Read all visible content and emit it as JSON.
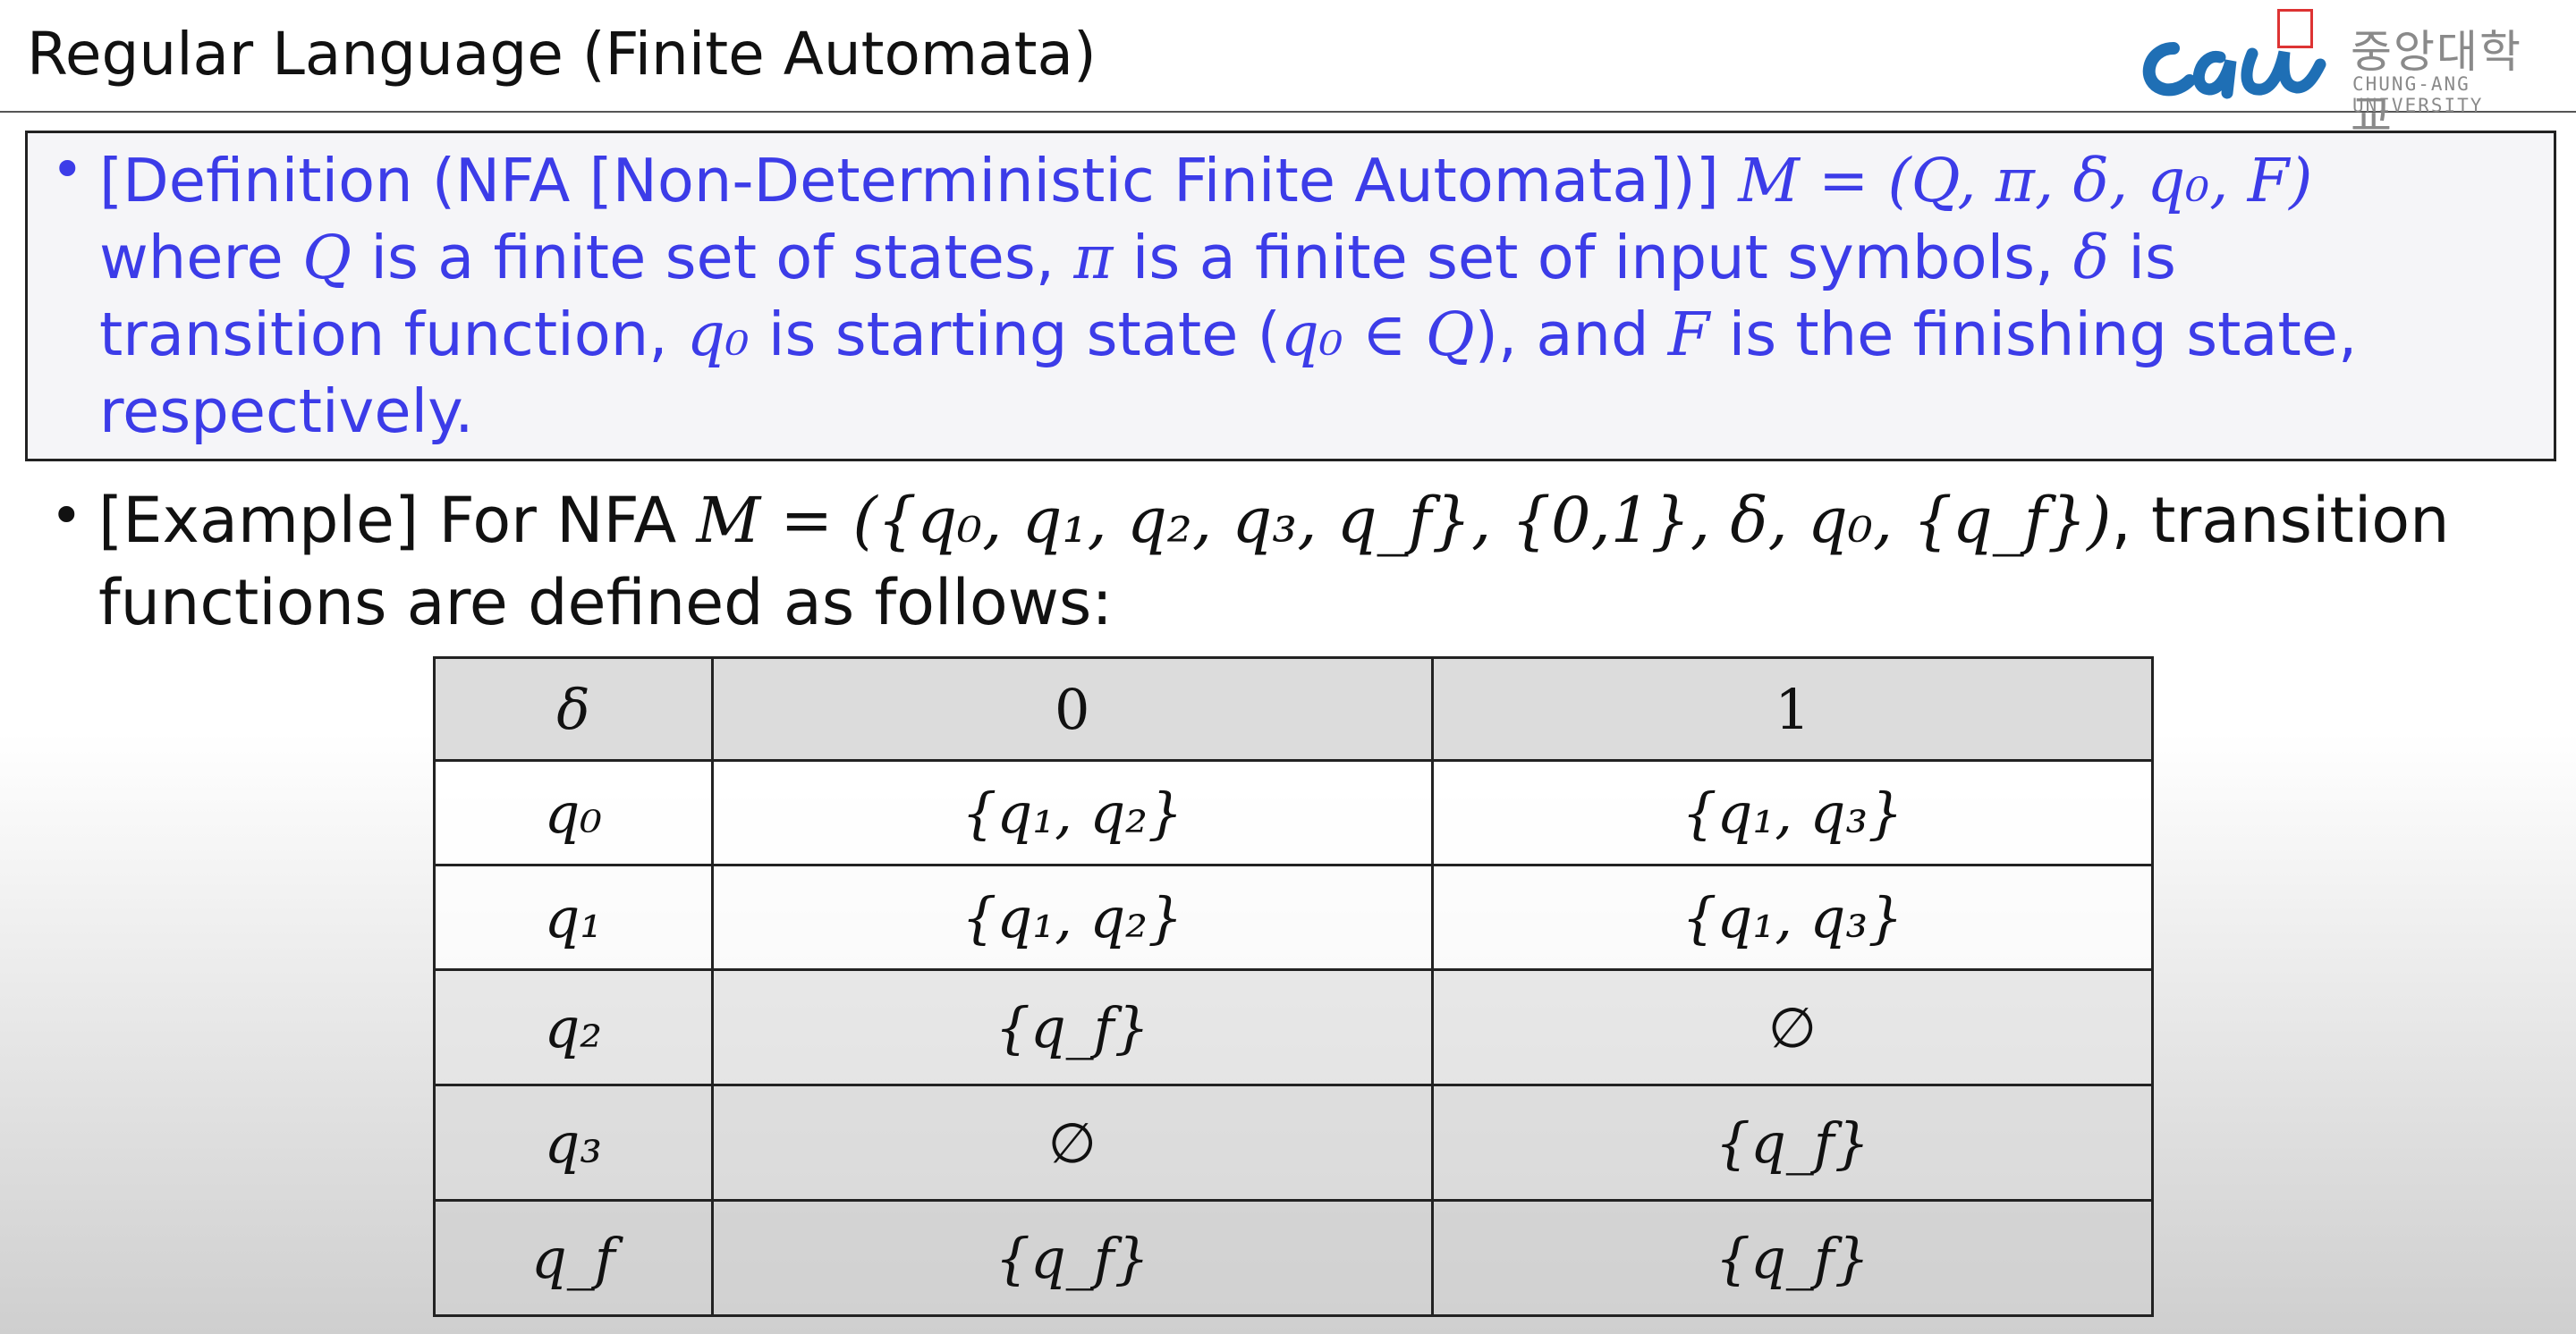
{
  "title": "Regular Language (Finite Automata)",
  "logo": {
    "mark": "CAU",
    "korean": "중앙대학교",
    "english": "CHUNG-ANG UNIVERSITY"
  },
  "definition": {
    "bullet": "•",
    "label": "[Definition (NFA [Non-Deterministic Finite Automata])]",
    "formula": "M = (Q, π, δ, q₀, F)",
    "line2_a": "where",
    "Q": "Q",
    "line2_b": "is a finite set of states,",
    "pi": "π",
    "line2_c": "is a finite set of input symbols,",
    "delta": "δ",
    "line2_d": "is",
    "line3_a": "transition function,",
    "q0": "q₀",
    "line3_b": "is starting state (",
    "q0_in_Q": "q₀ ∈ Q",
    "line3_c": "), and",
    "F": "F",
    "line3_d": "is the finishing state,",
    "line4": "respectively."
  },
  "example": {
    "bullet": "•",
    "label": "[Example] For NFA",
    "formula": "M = ({q₀, q₁, q₂, q₃, q_f}, {0,1}, δ, q₀, {q_f})",
    "suffix": ", transition",
    "line2": "functions are defined as follows:"
  },
  "table": {
    "headers": [
      "δ",
      "0",
      "1"
    ],
    "rows": [
      [
        "q₀",
        "{q₁, q₂}",
        "{q₁, q₃}"
      ],
      [
        "q₁",
        "{q₁, q₂}",
        "{q₁, q₃}"
      ],
      [
        "q₂",
        "{q_f}",
        "∅"
      ],
      [
        "q₃",
        "∅",
        "{q_f}"
      ],
      [
        "q_f",
        "{q_f}",
        "{q_f}"
      ]
    ]
  },
  "colors": {
    "definition_text": "#3c3ce8",
    "text": "#111111",
    "logo_blue": "#1f6fb5"
  }
}
